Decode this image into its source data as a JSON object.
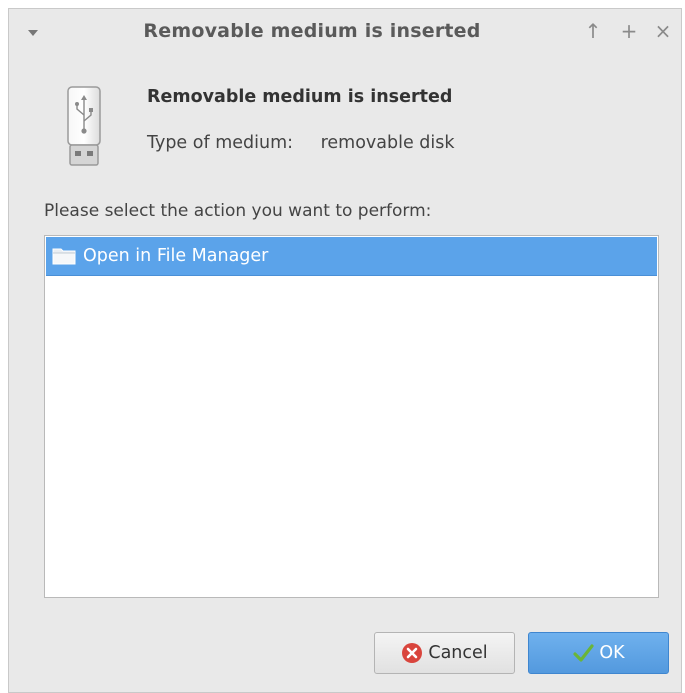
{
  "window": {
    "title": "Removable medium is inserted",
    "controls": {
      "menu": "window-menu-icon",
      "up": "↑",
      "maximize": "+",
      "close": "×"
    }
  },
  "content": {
    "heading": "Removable medium is inserted",
    "type_label": "Type of medium:",
    "type_value": "removable disk",
    "prompt": "Please select the action you want to perform:"
  },
  "actions": [
    {
      "label": "Open in File Manager",
      "icon": "folder-icon",
      "selected": true
    }
  ],
  "buttons": {
    "cancel_label": "Cancel",
    "ok_label": "OK"
  },
  "colors": {
    "selection": "#5ba3ea",
    "ok_button": "#5399de",
    "cancel_icon": "#d9453d",
    "ok_icon": "#6ab539"
  }
}
